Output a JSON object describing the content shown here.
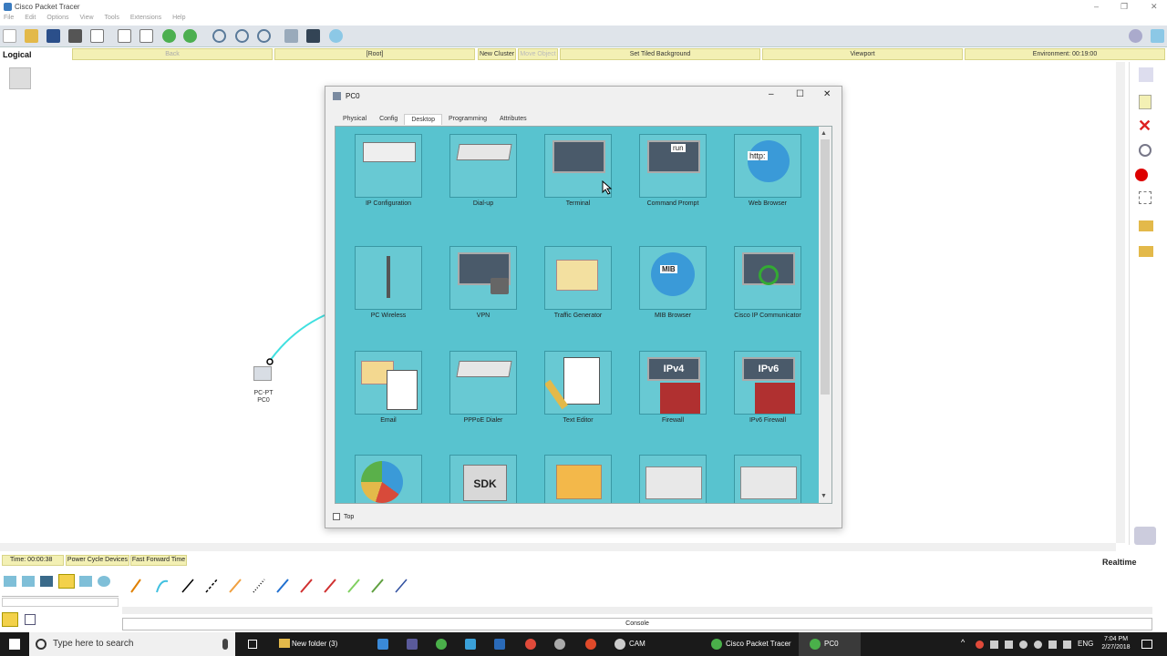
{
  "app_title": "Cisco Packet Tracer",
  "menu": [
    "File",
    "Edit",
    "Options",
    "View",
    "Tools",
    "Extensions",
    "Help"
  ],
  "navbar": {
    "mode": "Logical",
    "back": "Back",
    "root": "[Root]",
    "new_cluster": "New Cluster",
    "move_object": "Move Object",
    "tiled_bg": "Set Tiled Background",
    "viewport": "Viewport",
    "environment": "Environment: 00:19:00"
  },
  "device": {
    "type": "PC-PT",
    "name": "PC0"
  },
  "dialog": {
    "title": "PC0",
    "tabs": [
      "Physical",
      "Config",
      "Desktop",
      "Programming",
      "Attributes"
    ],
    "active_tab": "Desktop",
    "apps": [
      {
        "label": "IP Configuration",
        "icon": "ip-configuration-icon"
      },
      {
        "label": "Dial-up",
        "icon": "dialup-modem-icon"
      },
      {
        "label": "Terminal",
        "icon": "terminal-icon"
      },
      {
        "label": "Command Prompt",
        "icon": "command-prompt-icon",
        "text": "run"
      },
      {
        "label": "Web Browser",
        "icon": "web-browser-icon",
        "text": "http:"
      },
      {
        "label": "PC Wireless",
        "icon": "wireless-antenna-icon"
      },
      {
        "label": "VPN",
        "icon": "vpn-lock-icon"
      },
      {
        "label": "Traffic Generator",
        "icon": "traffic-generator-icon"
      },
      {
        "label": "MIB Browser",
        "icon": "mib-browser-icon",
        "text": "MIB"
      },
      {
        "label": "Cisco IP Communicator",
        "icon": "ip-communicator-icon"
      },
      {
        "label": "Email",
        "icon": "email-icon"
      },
      {
        "label": "PPPoE Dialer",
        "icon": "pppoe-dialer-icon"
      },
      {
        "label": "Text Editor",
        "icon": "text-editor-icon"
      },
      {
        "label": "Firewall",
        "icon": "firewall-icon",
        "text": "IPv4"
      },
      {
        "label": "IPv6 Firewall",
        "icon": "ipv6-firewall-icon",
        "text": "IPv6"
      },
      {
        "label": "",
        "icon": "netflow-chart-icon"
      },
      {
        "label": "",
        "icon": "sdk-icon",
        "text": "SDK"
      },
      {
        "label": "",
        "icon": "file-manager-icon"
      },
      {
        "label": "",
        "icon": "iot-cloud-icon"
      },
      {
        "label": "",
        "icon": "iot-cloud-icon-2"
      }
    ],
    "top_checkbox": "Top"
  },
  "bottom": {
    "time": "Time: 00:00:38",
    "power_cycle": "Power Cycle Devices",
    "fast_forward": "Fast Forward Time",
    "realtime": "Realtime",
    "console": "Console"
  },
  "taskbar": {
    "search_placeholder": "Type here to search",
    "apps": [
      "New folder (3)",
      "CAM",
      "Cisco Packet Tracer",
      "PC0"
    ],
    "lang": "ENG",
    "time": "7:04 PM",
    "date": "2/27/2018"
  },
  "colors": {
    "desktop_bg": "#58c3cf",
    "nav_button": "#f3f0b4",
    "toolbar": "#dfe4ea"
  }
}
